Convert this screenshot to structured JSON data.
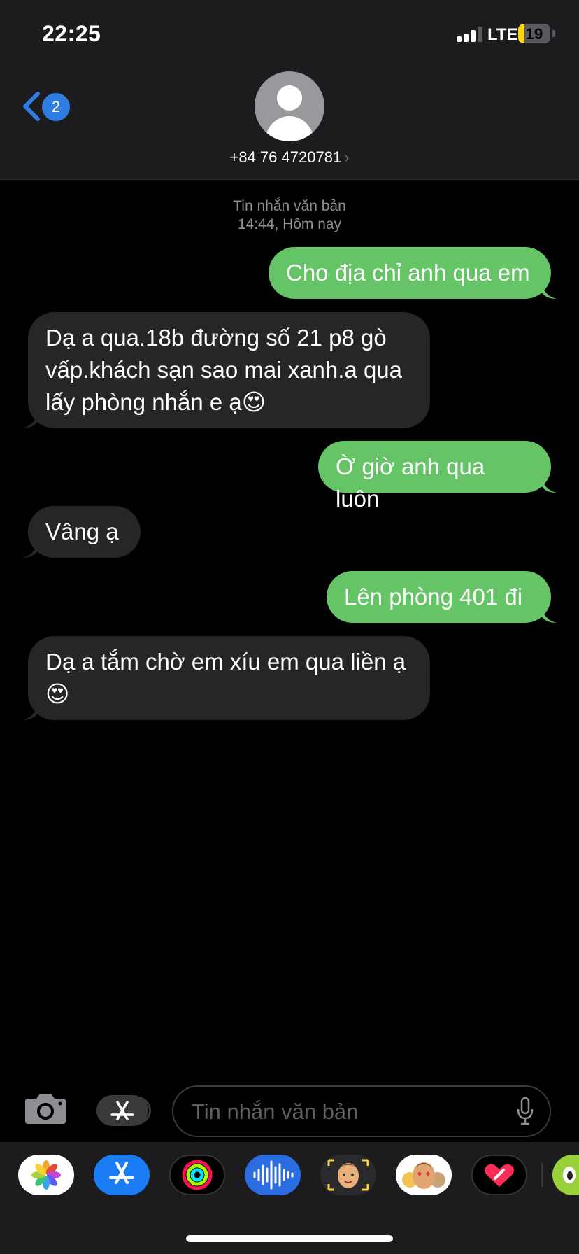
{
  "status_bar": {
    "time": "22:25",
    "network": "LTE",
    "battery_level": "19",
    "battery_fraction": 0.19,
    "signal_bars_active": 3,
    "signal_bars_total": 4
  },
  "header": {
    "back_badge": "2",
    "contact_name": "+84 76 4720781",
    "contact_chevron": "›"
  },
  "conversation": {
    "meta_type": "Tin nhắn văn bản",
    "meta_time": "14:44, Hôm nay",
    "messages": [
      {
        "direction": "outgoing",
        "text": "Cho địa chỉ anh qua em"
      },
      {
        "direction": "incoming",
        "text": "Dạ a qua.18b đường số 21 p8 gò vấp.khách sạn sao mai xanh.a qua lấy phòng nhắn e ạ😍"
      },
      {
        "direction": "outgoing",
        "text": "Ờ giờ anh qua luôn"
      },
      {
        "direction": "incoming",
        "text": "Vâng ạ"
      },
      {
        "direction": "outgoing",
        "text": "Lên phòng 401 đi"
      },
      {
        "direction": "incoming",
        "text": "Dạ a tắm chờ em xíu em qua liền ạ 😍"
      }
    ]
  },
  "input_bar": {
    "placeholder": "Tin nhắn văn bản",
    "camera_icon": "camera-icon",
    "apps_icon": "app-store-icon",
    "mic_icon": "microphone-icon"
  },
  "app_drawer": {
    "apps": [
      "photos-icon",
      "app-store-icon",
      "activity-icon",
      "audio-message-icon",
      "memoji-icon",
      "memoji-stickers-icon",
      "digital-touch-icon",
      "more-apps-icon"
    ]
  },
  "colors": {
    "outgoing_bubble": "#65c466",
    "incoming_bubble": "#262628",
    "accent_blue": "#2f7de1",
    "battery_low": "#ffd60a"
  }
}
